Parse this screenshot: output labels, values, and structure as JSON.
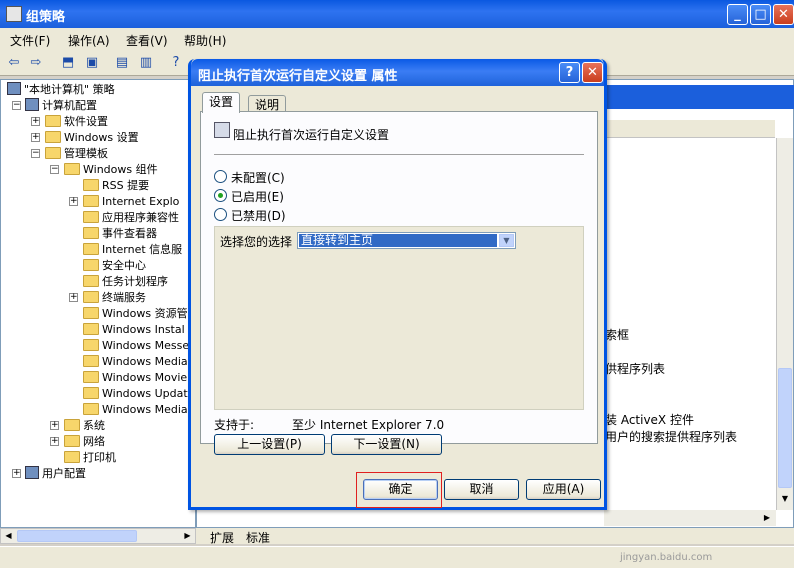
{
  "window": {
    "title": "组策略",
    "controls": {
      "minimize": "_",
      "maximize": "□",
      "close": "✕"
    }
  },
  "menubar": [
    "文件(F)",
    "操作(A)",
    "查看(V)",
    "帮助(H)"
  ],
  "menu_labels": {
    "file": "文件(F)",
    "action": "操作(A)",
    "view": "查看(V)",
    "help": "帮助(H)"
  },
  "toolbar": {
    "back": "⇦",
    "forward": "⇨",
    "up": "⬒",
    "show_hide": "▣",
    "properties": "▤",
    "export": "▥",
    "help": "?"
  },
  "tree": {
    "root": "\"本地计算机\" 策略",
    "computer_config": "计算机配置",
    "software_settings": "软件设置",
    "windows_settings": "Windows 设置",
    "admin_templates": "管理模板",
    "windows_components": "Windows 组件",
    "rss": "RSS 提要",
    "ie": "Internet Explo",
    "app_compat": "应用程序兼容性",
    "event_viewer": "事件查看器",
    "ie_info": "Internet 信息服",
    "security_center": "安全中心",
    "task_scheduler": "任务计划程序",
    "terminal_services": "终端服务",
    "win_explorer": "Windows 资源管",
    "win_installer": "Windows Instal",
    "win_messenger": "Windows Messen",
    "win_media1": "Windows Media ",
    "win_movie": "Windows Movie ",
    "win_update": "Windows Update",
    "win_media2": "Windows Media ",
    "system": "系统",
    "network": "网络",
    "printers": "打印机",
    "user_config": "用户配置"
  },
  "right_pane": {
    "item1": "索框",
    "item2": "供程序列表",
    "item3": "装 ActiveX 控件",
    "item4": "用户的搜索提供程序列表"
  },
  "bottom_tabs": {
    "extended": "扩展",
    "standard": "标准"
  },
  "dialog": {
    "title": "阻止执行首次运行自定义设置 属性",
    "help_button": "?",
    "close_button": "✕",
    "tabs": {
      "settings": "设置",
      "explain": "说明"
    },
    "policy_name": "阻止执行首次运行自定义设置",
    "options": {
      "not_configured": "未配置(C)",
      "enabled": "已启用(E)",
      "disabled": "已禁用(D)"
    },
    "selected_option": "enabled",
    "choose_label": "选择您的选择",
    "choice_value": "直接转到主页",
    "supported_label": "支持于:",
    "supported_value": "至少 Internet Explorer 7.0",
    "prev_button": "上一设置(P)",
    "next_button": "下一设置(N)",
    "ok_button": "确定",
    "cancel_button": "取消",
    "apply_button": "应用(A)"
  },
  "watermark": "jingyan.baidu.com"
}
